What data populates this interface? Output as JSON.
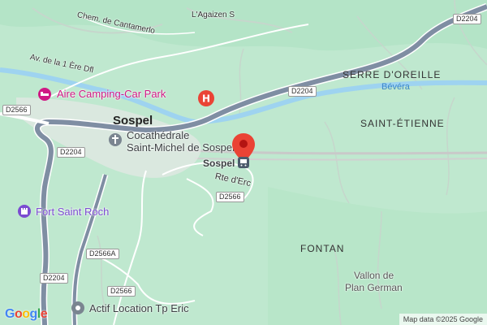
{
  "places": {
    "sospel": "Sospel",
    "saint_etienne": "SAINT-ÉTIENNE",
    "serre": "SERRE D'OREILLE",
    "fontan": "FONTAN",
    "vallon": "Vallon de",
    "vallon2": "Plan German"
  },
  "streets": {
    "cantamerlo": "Chem. de Cantamerlo",
    "agaizen": "L'Agaizen S",
    "av_1ere": "Av. de la 1 Ère Dfl",
    "rte_erc": "Rte d'Erc"
  },
  "rivers": {
    "bevera": "Bévéra"
  },
  "roads": {
    "d2204_top": "D2204",
    "d2204_mid": "D2204",
    "d2204_left": "D2204",
    "d2204_bottom": "D2204",
    "d2566_left": "D2566",
    "d2566_center": "D2566",
    "d2566a": "D2566A",
    "d2566_bottom": "D2566"
  },
  "pois": {
    "camping": "Aire Camping-Car Park",
    "cathedral_1": "Cocathédrale",
    "cathedral_2": "Saint-Michel de Sospel",
    "station": "Sospel",
    "fort": "Fort Saint Roch",
    "actif": "Actif Location Tp Eric"
  },
  "branding": {
    "logo": "Google",
    "attribution": "Map data ©2025 Google"
  },
  "colors": {
    "land": "#bfe8cf",
    "road_major": "#7f8ea3",
    "water": "#9ed3f0",
    "pin": "#ea4335",
    "pink": "#d01884",
    "purple": "#7b4bd1"
  },
  "icons": {
    "pin": "map-pin-icon",
    "hospital": "hospital-icon",
    "bed": "bed-icon",
    "church": "church-icon",
    "train": "train-icon",
    "castle": "castle-icon",
    "business": "business-icon"
  }
}
